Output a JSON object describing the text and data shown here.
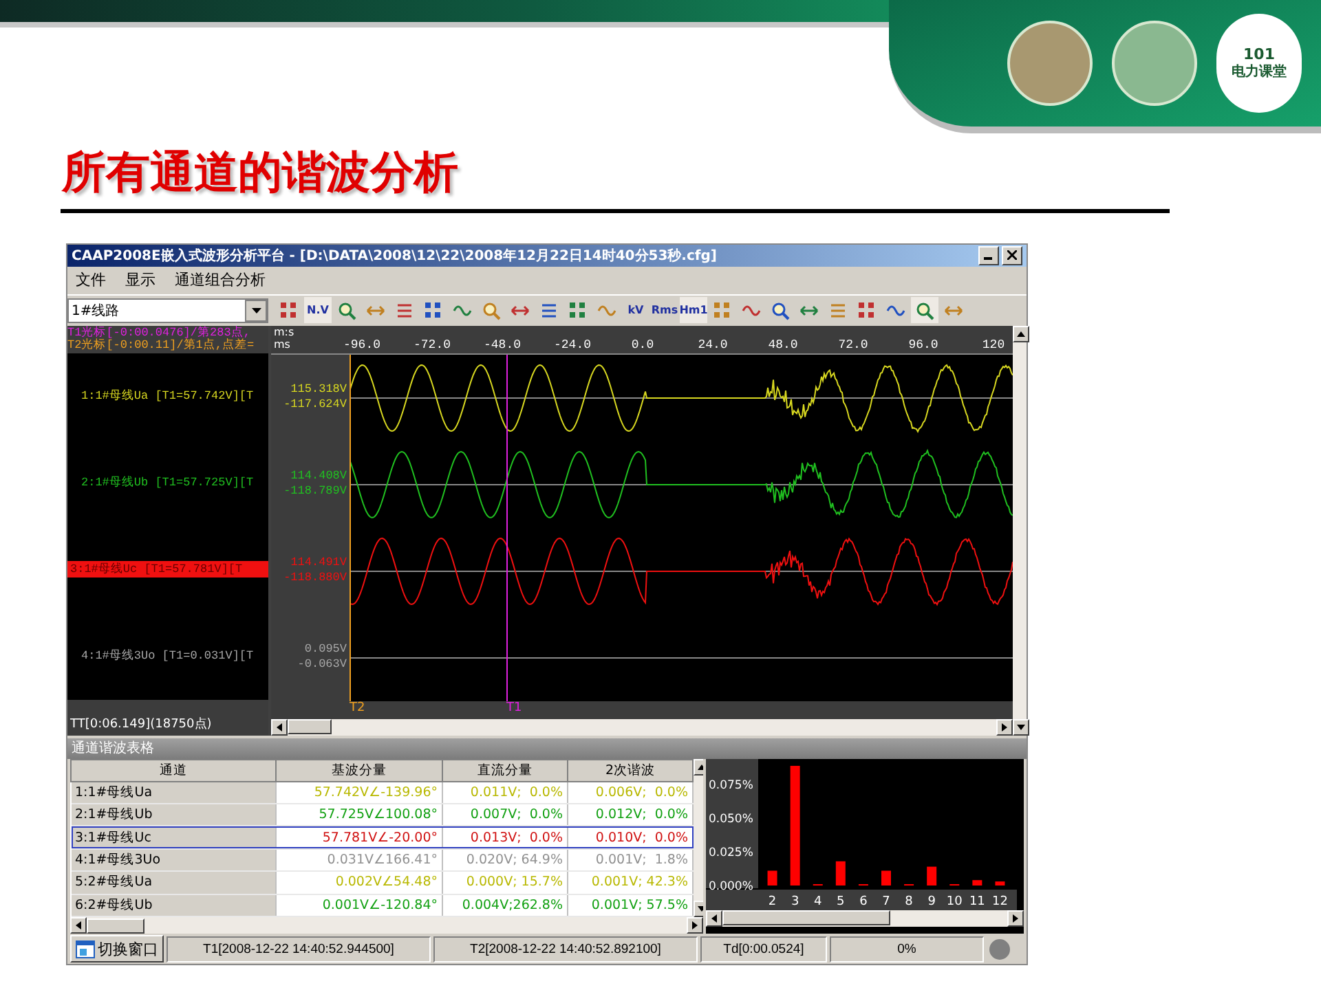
{
  "slide": {
    "title": "所有通道的谐波分析",
    "logo": {
      "number": "101",
      "name": "电力课堂"
    }
  },
  "window": {
    "title": "CAAP2008E嵌入式波形分析平台 - [D:\\DATA\\2008\\12\\22\\2008年12月22日14时40分53秒.cfg]"
  },
  "menu": [
    "文件",
    "显示",
    "通道组合分析"
  ],
  "line_select": {
    "value": "1#线路"
  },
  "toolbar": [
    {
      "kind": "icon",
      "selected": false
    },
    {
      "kind": "text",
      "label": "N.V",
      "selected": true
    },
    {
      "kind": "icon",
      "selected": false
    },
    {
      "kind": "icon",
      "selected": false
    },
    {
      "kind": "icon",
      "selected": false
    },
    {
      "kind": "icon",
      "selected": false
    },
    {
      "kind": "icon",
      "selected": false
    },
    {
      "kind": "icon",
      "selected": false
    },
    {
      "kind": "icon",
      "selected": false
    },
    {
      "kind": "icon",
      "selected": false
    },
    {
      "kind": "icon",
      "selected": false
    },
    {
      "kind": "icon",
      "selected": false
    },
    {
      "kind": "text",
      "label": "kV",
      "selected": false
    },
    {
      "kind": "text",
      "label": "Rms",
      "selected": false
    },
    {
      "kind": "text",
      "label": "Hm1",
      "selected": true
    },
    {
      "kind": "icon",
      "selected": false
    },
    {
      "kind": "icon",
      "selected": false
    },
    {
      "kind": "icon",
      "selected": false
    },
    {
      "kind": "icon",
      "selected": false
    },
    {
      "kind": "icon",
      "selected": false
    },
    {
      "kind": "icon",
      "selected": false
    },
    {
      "kind": "icon",
      "selected": false
    },
    {
      "kind": "icon",
      "selected": true
    },
    {
      "kind": "icon",
      "selected": false
    }
  ],
  "cursors": [
    {
      "text": "T1光标[-0:00.0476]/第283点,",
      "color": "#e020e0"
    },
    {
      "text": "T2光标[-0:00.11]/第1点,点差=",
      "color": "#f0a020"
    }
  ],
  "markers": [
    "T2",
    "T1"
  ],
  "channels": [
    {
      "label": "1:1#母线Ua [T1=57.742V][T",
      "max": "115.318V",
      "min": "-117.624V",
      "color": "#d8d820",
      "selected": false
    },
    {
      "label": "2:1#母线Ub [T1=57.725V][T",
      "max": "114.408V",
      "min": "-118.789V",
      "color": "#20c020",
      "selected": false
    },
    {
      "label": "3:1#母线Uc [T1=57.781V][T",
      "max": "114.491V",
      "min": "-118.880V",
      "color": "#f01010",
      "selected": true
    },
    {
      "label": "4:1#母线3Uo [T1=0.031V][T",
      "max": "0.095V",
      "min": "-0.063V",
      "color": "#a8a8a8",
      "selected": false
    }
  ],
  "total": "TT[0:06.149](18750点)",
  "axis": {
    "units": [
      "m:s",
      "ms"
    ],
    "ticks": [
      "-96.0",
      "-72.0",
      "-48.0",
      "-24.0",
      "0.0",
      "24.0",
      "48.0",
      "72.0",
      "96.0",
      "120"
    ]
  },
  "harmonics": {
    "title": "通道谐波表格",
    "columns": [
      "通道",
      "基波分量",
      "直流分量",
      "2次谐波"
    ],
    "rows": [
      {
        "cells": [
          "1:1#母线Ua",
          "57.742V∠-139.96°",
          "0.011V;  0.0%",
          "0.006V;  0.0%"
        ],
        "color": "#b8b800",
        "selected": false
      },
      {
        "cells": [
          "2:1#母线Ub",
          "57.725V∠100.08°",
          "0.007V;  0.0%",
          "0.012V;  0.0%"
        ],
        "color": "#10a010",
        "selected": false
      },
      {
        "cells": [
          "3:1#母线Uc",
          "57.781V∠-20.00°",
          "0.013V;  0.0%",
          "0.010V;  0.0%"
        ],
        "color": "#d01010",
        "selected": true
      },
      {
        "cells": [
          "4:1#母线3Uo",
          "0.031V∠166.41°",
          "0.020V; 64.9%",
          "0.001V;  1.8%"
        ],
        "color": "#909090",
        "selected": false
      },
      {
        "cells": [
          "5:2#母线Ua",
          "0.002V∠54.48°",
          "0.000V; 15.7%",
          "0.001V; 42.3%"
        ],
        "color": "#b8b800",
        "selected": false
      },
      {
        "cells": [
          "6:2#母线Ub",
          "0.001V∠-120.84°",
          "0.004V;262.8%",
          "0.001V; 57.5%"
        ],
        "color": "#10a010",
        "selected": false
      }
    ]
  },
  "chart": {
    "chart_data": {
      "type": "bar",
      "categories": [
        "2",
        "3",
        "4",
        "5",
        "6",
        "7",
        "8",
        "9",
        "10",
        "11",
        "12"
      ],
      "series": [
        {
          "color": "#ff0000",
          "values": [
            0.011,
            0.089,
            0.001,
            0.018,
            0.001,
            0.011,
            0.001,
            0.014,
            0.001,
            0.004,
            0.003
          ]
        }
      ],
      "ylim": [
        0,
        0.09
      ],
      "yticks": [
        {
          "value": 0,
          "label": "0.000%"
        },
        {
          "value": 0.025,
          "label": "0.025%"
        },
        {
          "value": 0.05,
          "label": "0.050%"
        },
        {
          "value": 0.075,
          "label": "0.075%"
        }
      ]
    }
  },
  "status_bar": {
    "button": "切换窗口",
    "fields": [
      "T1[2008-12-22 14:40:52.944500]",
      "T2[2008-12-22 14:40:52.892100]",
      "Td[0:00.0524]"
    ],
    "progress": "0%"
  }
}
